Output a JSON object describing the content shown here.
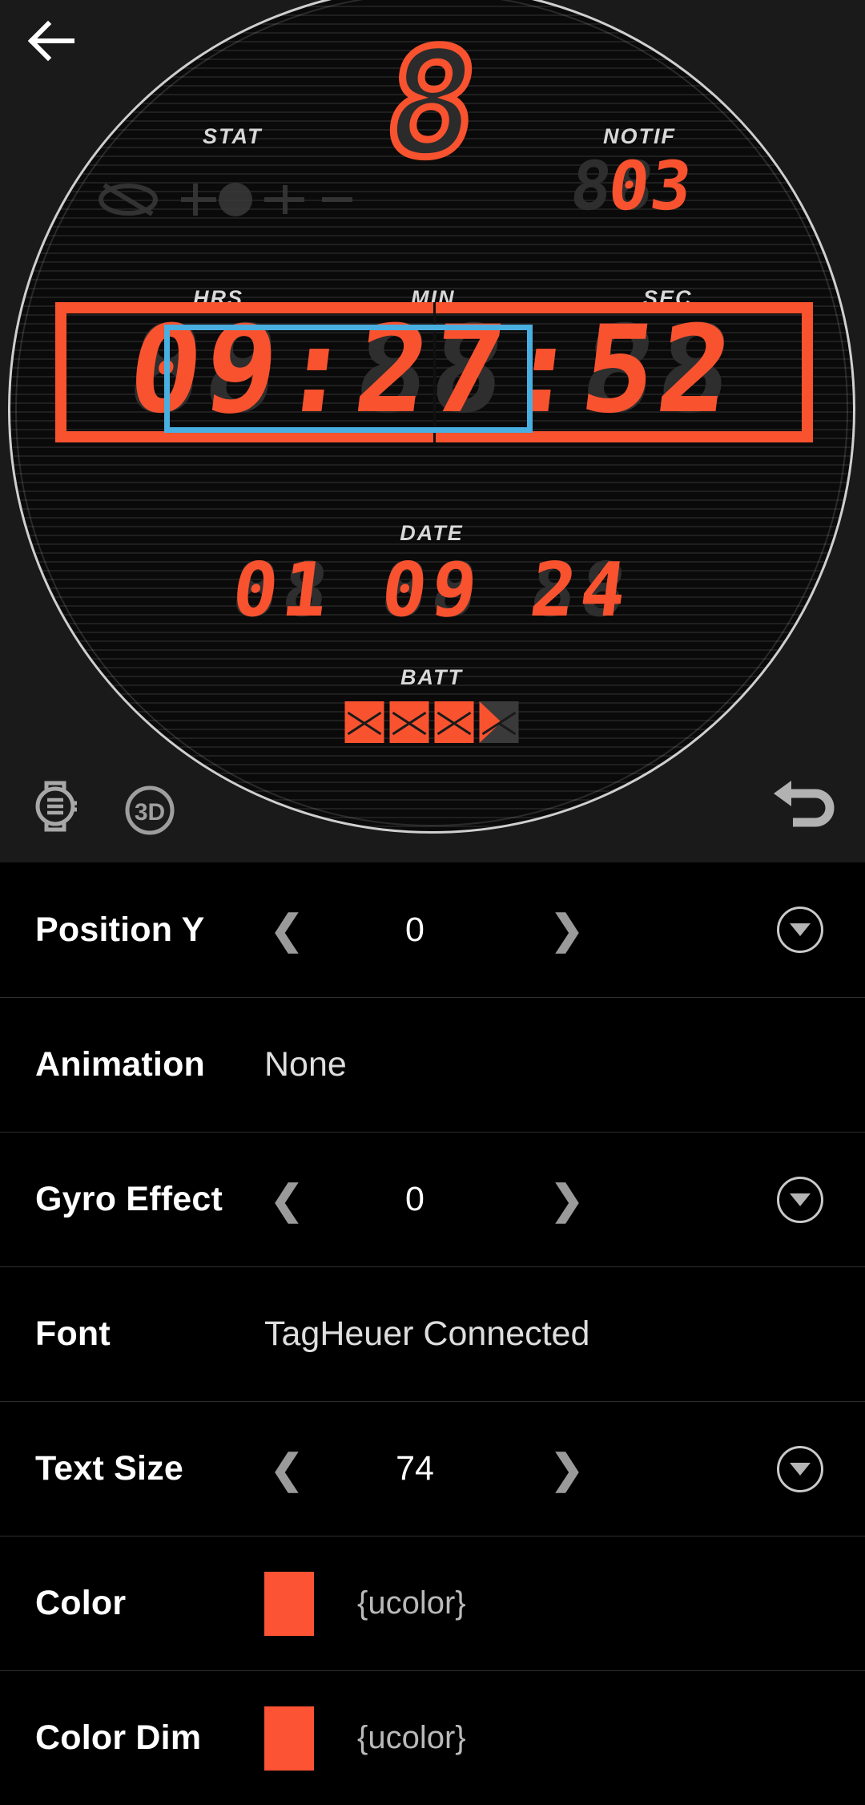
{
  "header": {
    "back_icon": "back-arrow-icon"
  },
  "preview": {
    "watch_face": {
      "top_digit": "8",
      "labels": {
        "stat": "STAT",
        "notif": "NOTIF",
        "hrs": "HRS",
        "min": "MIN",
        "sec": "SEC",
        "date": "DATE",
        "batt": "BATT"
      },
      "notif_count": "03",
      "notif_ghost": "88",
      "time_ghost": "88:88:88",
      "time_value": "09:27:52",
      "date_ghost": "88 88 88",
      "date_value": "01 09 24",
      "battery_cells_full": 3,
      "battery_cells_partial": 1,
      "accent_color": "#f9522f",
      "ghost_color": "#2e2e2e",
      "selection_color": "#49aee0"
    },
    "tools": {
      "watch_mode_icon": "watch-mode-icon",
      "three_d_icon": "3D",
      "undo_icon": "undo-icon"
    }
  },
  "settings": {
    "rows": [
      {
        "label": "Position Y",
        "type": "stepper",
        "value": "0",
        "prev_icon": "❮",
        "next_icon": "❯",
        "has_dropdown": true
      },
      {
        "label": "Animation",
        "type": "text",
        "value": "None",
        "has_dropdown": false
      },
      {
        "label": "Gyro Effect",
        "type": "stepper",
        "value": "0",
        "prev_icon": "❮",
        "next_icon": "❯",
        "has_dropdown": true
      },
      {
        "label": "Font",
        "type": "text",
        "value": "TagHeuer Connected",
        "has_dropdown": false
      },
      {
        "label": "Text Size",
        "type": "stepper",
        "value": "74",
        "prev_icon": "❮",
        "next_icon": "❯",
        "has_dropdown": true
      },
      {
        "label": "Color",
        "type": "color",
        "value": "{ucolor}",
        "swatch": "#fb5334",
        "has_dropdown": false
      },
      {
        "label": "Color Dim",
        "type": "color",
        "value": "{ucolor}",
        "swatch": "#fb5334",
        "has_dropdown": false
      }
    ]
  }
}
